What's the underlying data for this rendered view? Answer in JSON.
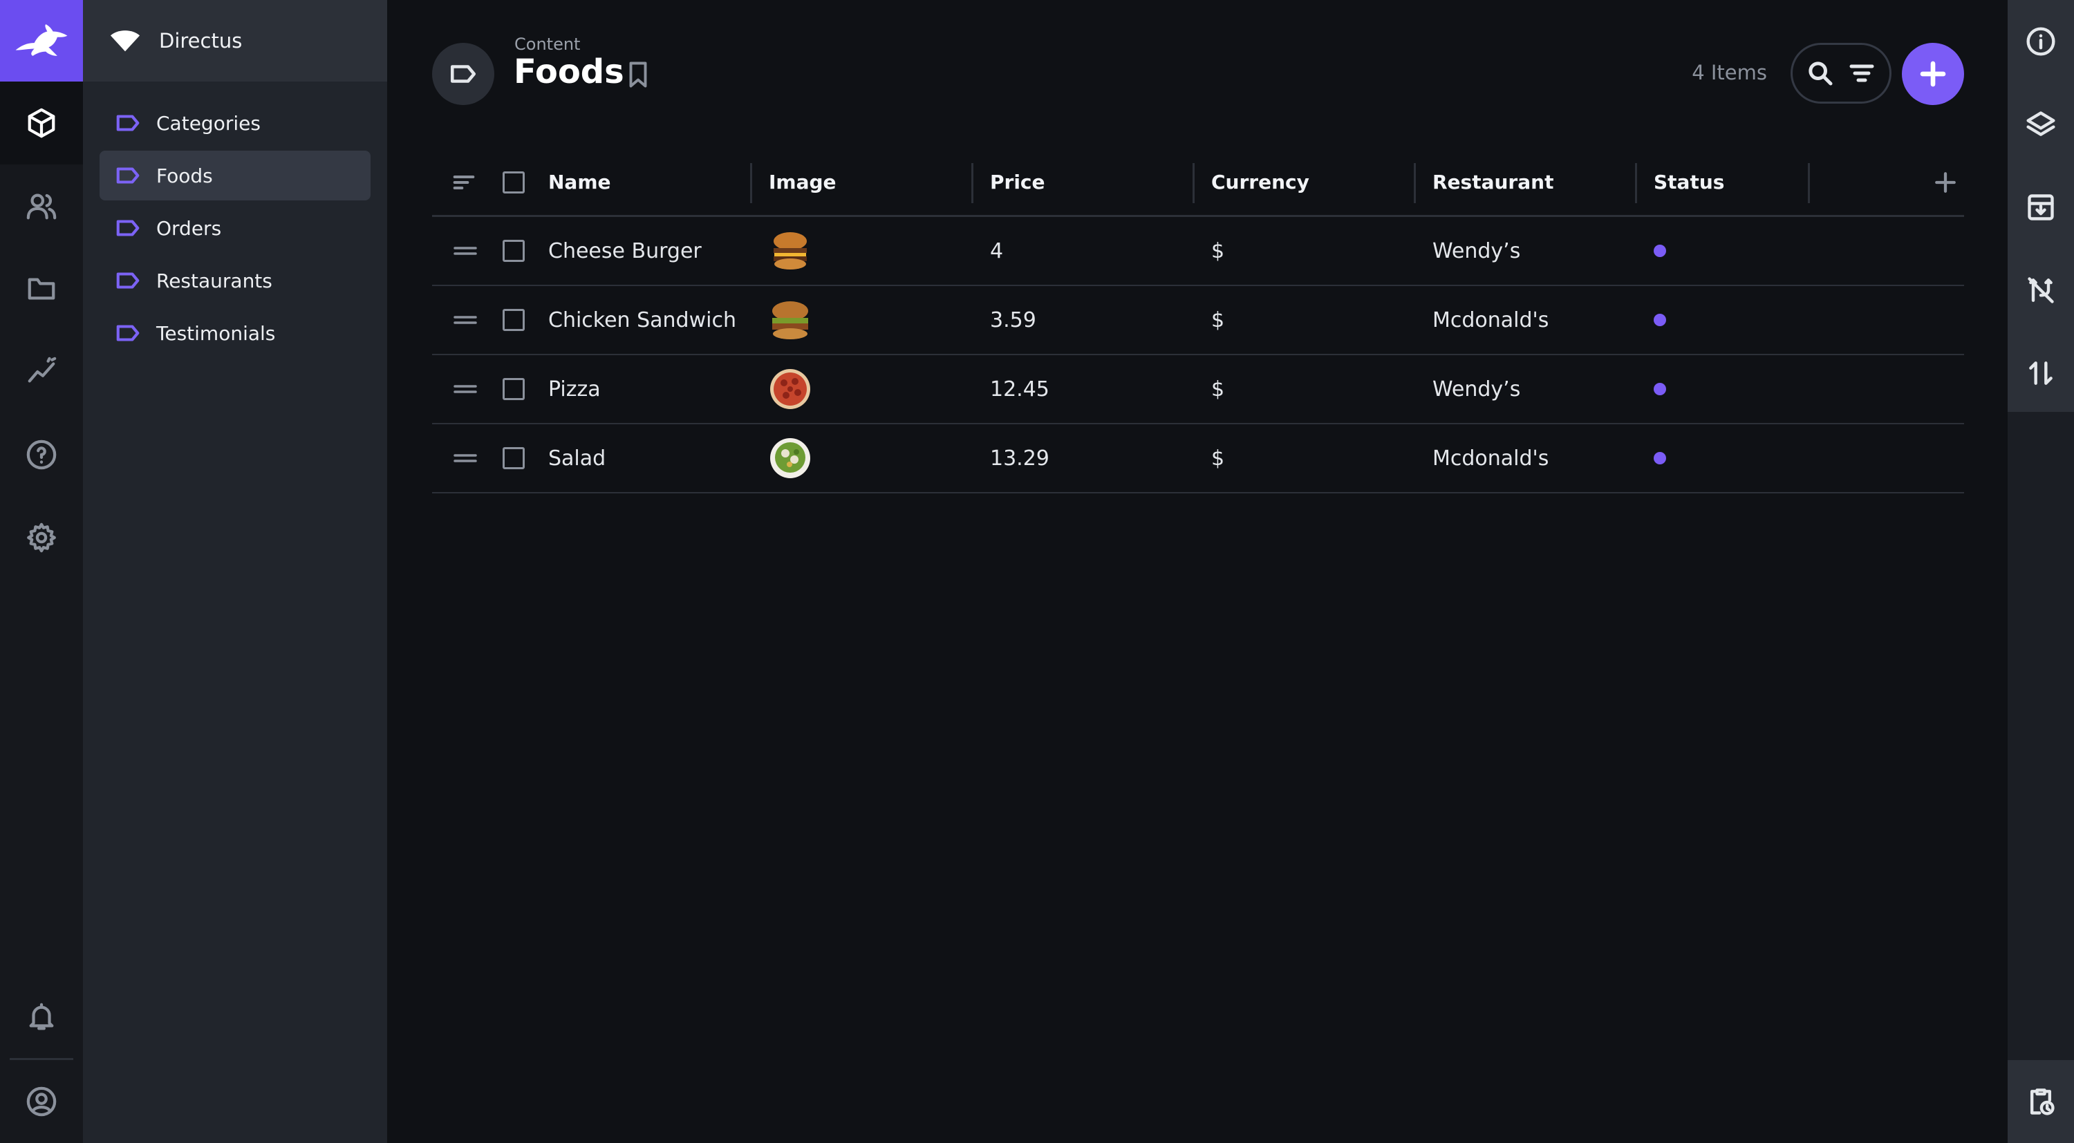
{
  "project": {
    "name": "Directus"
  },
  "nav": {
    "items": [
      {
        "label": "Categories",
        "active": false
      },
      {
        "label": "Foods",
        "active": true
      },
      {
        "label": "Orders",
        "active": false
      },
      {
        "label": "Restaurants",
        "active": false
      },
      {
        "label": "Testimonials",
        "active": false
      }
    ]
  },
  "modules": [
    "content-icon",
    "users-icon",
    "files-icon",
    "insights-icon",
    "help-icon",
    "settings-icon",
    "notifications-icon",
    "account-icon"
  ],
  "header": {
    "breadcrumb": "Content",
    "title": "Foods",
    "item_count": "4 Items"
  },
  "table": {
    "columns": [
      "Name",
      "Image",
      "Price",
      "Currency",
      "Restaurant",
      "Status"
    ],
    "rows": [
      {
        "name": "Cheese Burger",
        "image": "burger-thumbnail",
        "price": "4",
        "currency": "$",
        "restaurant": "Wendy’s",
        "status_color": "#7b5cf6"
      },
      {
        "name": "Chicken Sandwich",
        "image": "sandwich-thumbnail",
        "price": "3.59",
        "currency": "$",
        "restaurant": "Mcdonald's",
        "status_color": "#7b5cf6"
      },
      {
        "name": "Pizza",
        "image": "pizza-thumbnail",
        "price": "12.45",
        "currency": "$",
        "restaurant": "Wendy’s",
        "status_color": "#7b5cf6"
      },
      {
        "name": "Salad",
        "image": "salad-thumbnail",
        "price": "13.29",
        "currency": "$",
        "restaurant": "Mcdonald's",
        "status_color": "#7b5cf6"
      }
    ]
  },
  "sidebar": [
    "info-icon",
    "layers-icon",
    "archive-icon",
    "no-branch-icon",
    "import-export-icon",
    "flows-clipboard-icon"
  ],
  "colors": {
    "accent": "#7b5cf6",
    "module_bar": "#16181d",
    "nav_bg": "#21252c",
    "page_bg": "#0f1115"
  }
}
